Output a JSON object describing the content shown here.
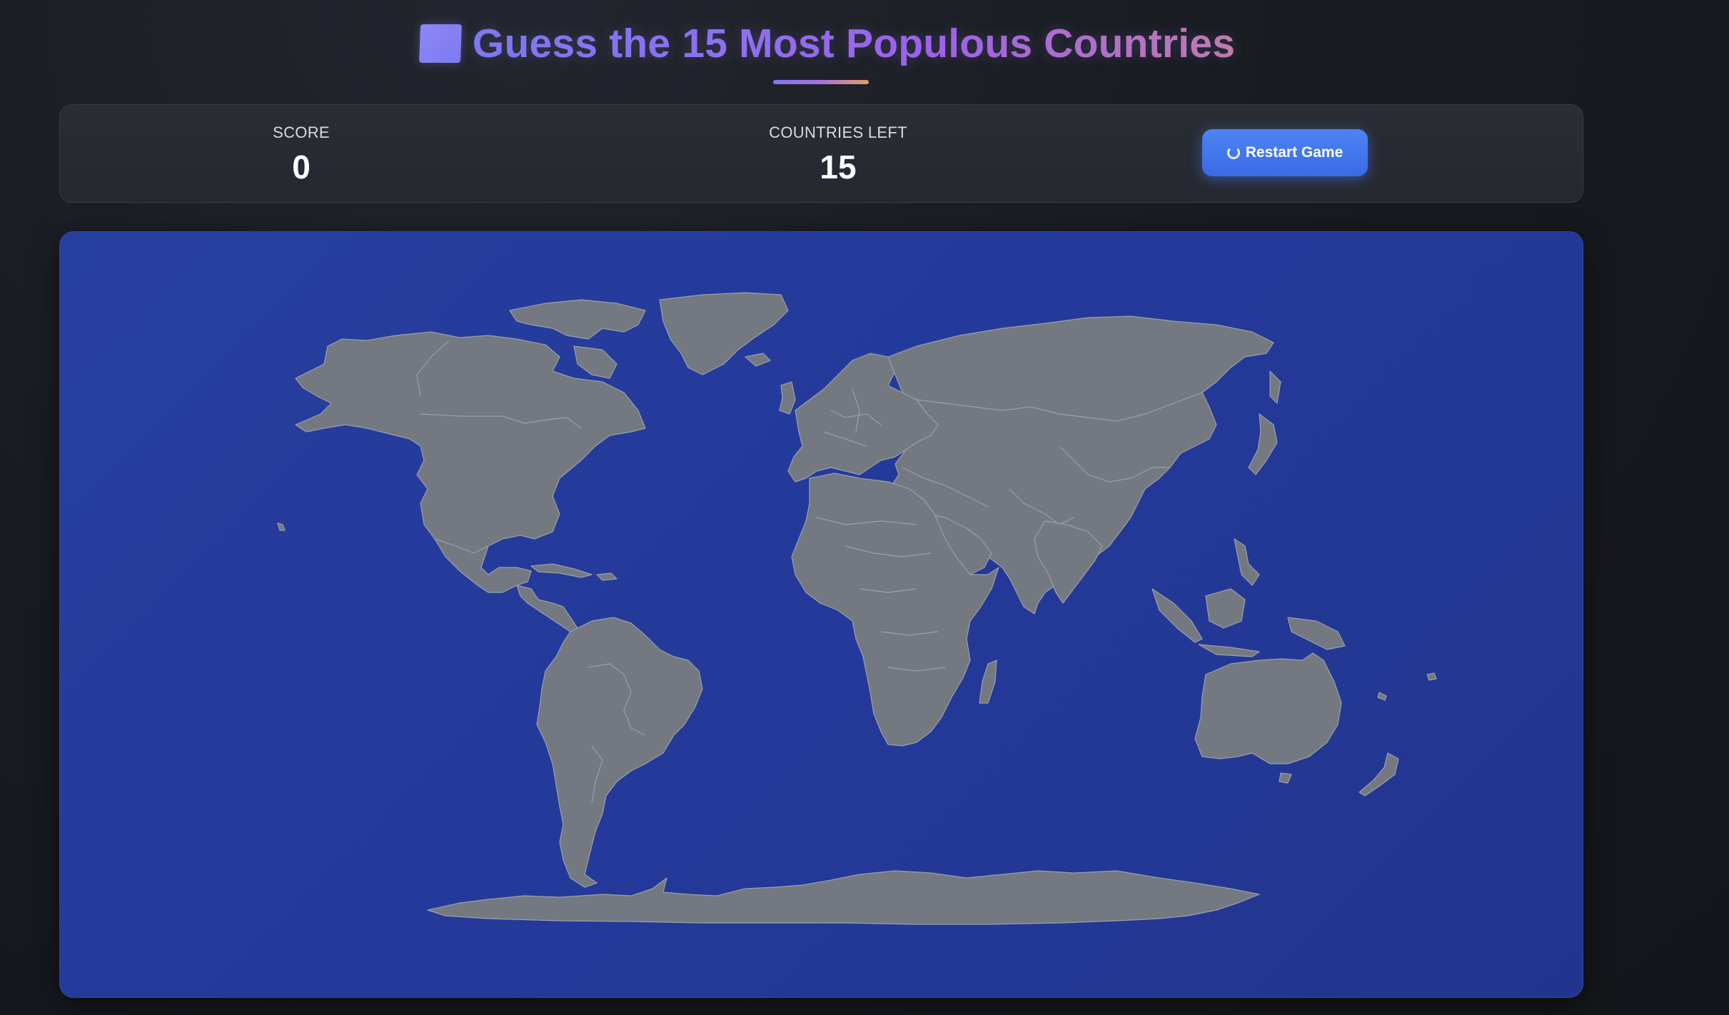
{
  "header": {
    "title": "Guess the 15 Most Populous Countries",
    "title_icon": "world-map-icon"
  },
  "stats": {
    "score_label": "SCORE",
    "score_value": "0",
    "countries_left_label": "COUNTRIES LEFT",
    "countries_left_value": "15"
  },
  "controls": {
    "restart_label": "Restart Game",
    "restart_icon": "refresh-icon"
  },
  "colors": {
    "accent_blue": "#3a6ae6",
    "map_ocean": "#24399a",
    "map_land": "#747981",
    "title_gradient_start": "#7b78f2",
    "title_gradient_end": "#c57ca6"
  }
}
